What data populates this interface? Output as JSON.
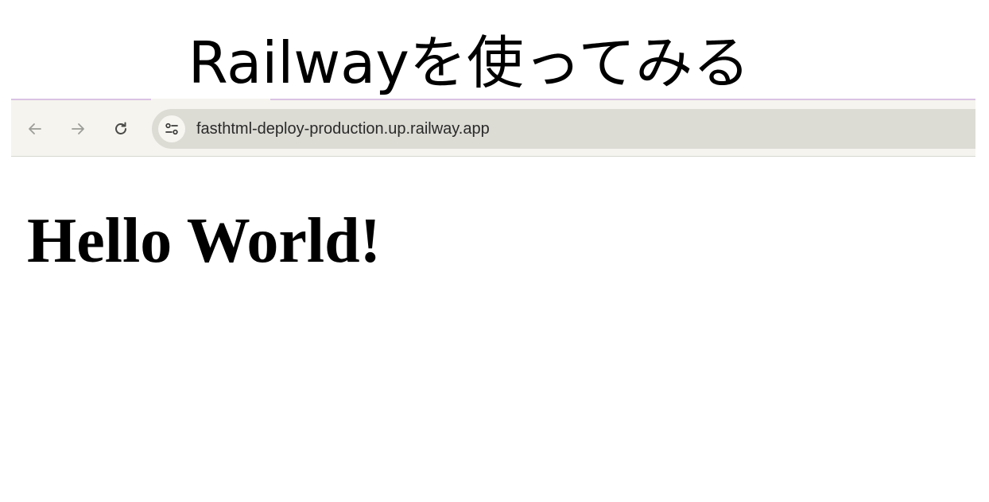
{
  "slide": {
    "title": "Railwayを使ってみる"
  },
  "browser": {
    "nav": {
      "back_icon": "arrow-left-icon",
      "forward_icon": "arrow-right-icon",
      "reload_icon": "reload-icon"
    },
    "address_bar": {
      "site_info_icon": "tune-icon",
      "url": "fasthtml-deploy-production.up.railway.app"
    }
  },
  "page": {
    "heading": "Hello World!"
  },
  "colors": {
    "toolbar_bg": "#f5f4ef",
    "omnibox_bg": "#dcdbd4",
    "accent_border": "#d9c2e3",
    "icon_disabled": "#9c9c98",
    "icon_active": "#4a4a48"
  }
}
